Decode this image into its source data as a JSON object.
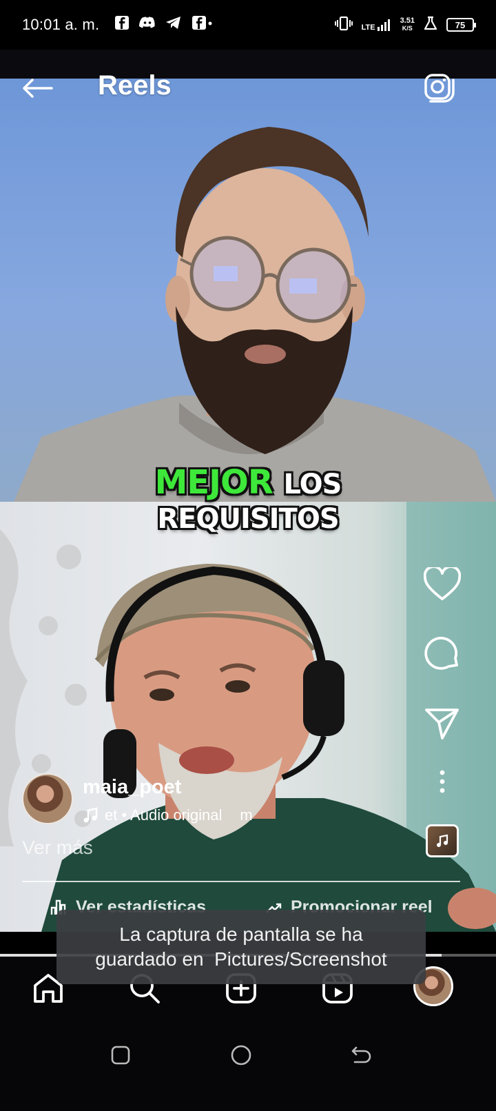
{
  "status_bar": {
    "time": "10:01 a. m.",
    "network": "LTE",
    "speed": "3.51",
    "speed_unit": "K/S",
    "battery": "75"
  },
  "header": {
    "title": "Reels"
  },
  "video": {
    "caption_highlight": "MEJOR",
    "caption_rest": "LOS",
    "caption_line2": "REQUISITOS",
    "highlight_color": "#3ee83a"
  },
  "post": {
    "username": "maia_poet",
    "audio_text": "et • Audio original",
    "audio_trailing": "m",
    "see_more": "Ver más"
  },
  "actions": {
    "stats_label": "Ver estadísticas",
    "promote_label": "Promocionar reel"
  },
  "progress": {
    "fraction": 0.89
  },
  "toast": {
    "line1": "La captura de pantalla se ha",
    "line2": "guardado en  Pictures/Screenshot"
  },
  "icons": [
    "facebook-icon",
    "discord-icon",
    "telegram-icon",
    "vibrate-icon",
    "signal-icon",
    "alarm-icon",
    "back-arrow-icon",
    "camera-icon",
    "heart-icon",
    "comment-icon",
    "share-icon",
    "more-icon",
    "music-note-icon",
    "home-icon",
    "search-icon",
    "create-icon",
    "reels-icon",
    "recent-apps-icon",
    "home-circle-icon",
    "back-icon"
  ]
}
